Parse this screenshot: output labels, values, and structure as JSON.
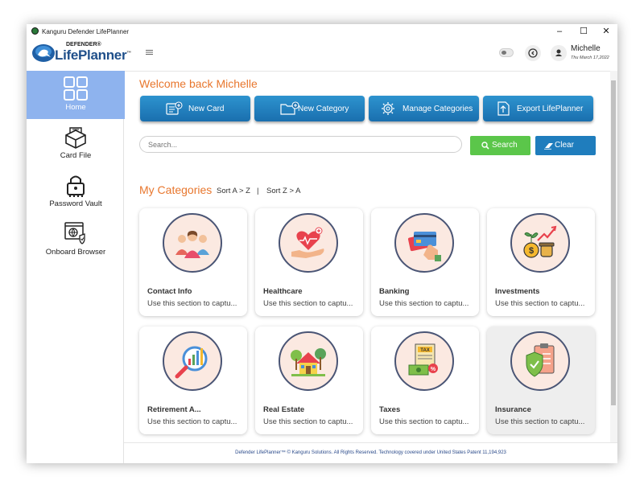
{
  "window": {
    "title": "Kanguru Defender LifePlanner",
    "controls": [
      "–",
      "☐",
      "✕"
    ]
  },
  "header": {
    "logo_small": "DEFENDER®",
    "logo_big": "LifePlanner",
    "logo_tm": "™",
    "user_name": "Michelle",
    "user_date": "Thu March 17,2022"
  },
  "sidebar": {
    "items": [
      {
        "label": "Home",
        "icon": "dashboard-icon"
      },
      {
        "label": "Card File",
        "icon": "card-file-icon"
      },
      {
        "label": "Password Vault",
        "icon": "lock-icon"
      },
      {
        "label": "Onboard Browser",
        "icon": "browser-shield-icon"
      }
    ]
  },
  "main": {
    "welcome": "Welcome back Michelle",
    "actions": [
      {
        "label": "New Card",
        "icon": "new-card-icon"
      },
      {
        "label": "New Category",
        "icon": "new-folder-icon"
      },
      {
        "label": "Manage Categories",
        "icon": "gear-icon"
      },
      {
        "label": "Export LifePlanner",
        "icon": "export-icon"
      }
    ],
    "search": {
      "placeholder": "Search...",
      "search_label": "Search",
      "clear_label": "Clear"
    },
    "categories_title": "My Categories",
    "sort_az": "Sort A > Z",
    "sort_sep": "|",
    "sort_za": "Sort Z > A",
    "categories": [
      {
        "title": "Contact Info",
        "desc": "Use this section to captu...",
        "icon": "people-icon"
      },
      {
        "title": "Healthcare",
        "desc": "Use this section to captu...",
        "icon": "heart-hand-icon"
      },
      {
        "title": "Banking",
        "desc": "Use this section to captu...",
        "icon": "credit-card-icon"
      },
      {
        "title": "Investments",
        "desc": "Use this section to captu...",
        "icon": "money-growth-icon"
      },
      {
        "title": "Retirement A...",
        "desc": "Use this section to captu...",
        "icon": "chart-magnifier-icon"
      },
      {
        "title": "Real Estate",
        "desc": "Use this section to captu...",
        "icon": "house-icon"
      },
      {
        "title": "Taxes",
        "desc": "Use this section to captu...",
        "icon": "tax-document-icon"
      },
      {
        "title": "Insurance",
        "desc": "Use this section to captu...",
        "icon": "shield-clipboard-icon"
      }
    ]
  },
  "footer": {
    "text": "Defender LifePlanner™ © Kanguru Solutions. All Rights Reserved. Technology covered under United States Patent 11,194,923"
  },
  "colors": {
    "accent_orange": "#e8772e",
    "button_blue": "#1f7dbd",
    "search_green": "#5bc64a",
    "sidebar_active": "#8eb3ee"
  }
}
